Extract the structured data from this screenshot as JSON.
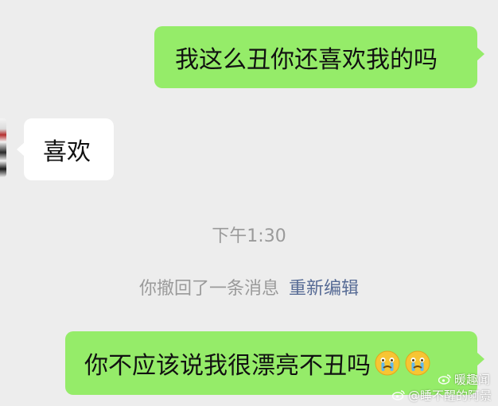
{
  "chat": {
    "messages": [
      {
        "side": "right",
        "text": "我这么丑你还喜欢我的吗"
      },
      {
        "side": "left",
        "text": "喜欢"
      },
      {
        "side": "right",
        "text": "你不应该说我很漂亮不丑吗",
        "emoji": [
          "crying-face",
          "crying-face"
        ]
      }
    ],
    "timestamp": "下午1:30",
    "recall_notice": {
      "text": "你撤回了一条消息",
      "action": "重新编辑"
    }
  },
  "watermark": {
    "line1": "暖趣闻",
    "line2": "@睡不醒的阿景",
    "icon": "weibo-logo"
  },
  "colors": {
    "background": "#EDEDED",
    "my_bubble": "#95EC69",
    "other_bubble": "#FFFFFF",
    "system_text": "#9A9A9A",
    "link": "#576B95"
  }
}
